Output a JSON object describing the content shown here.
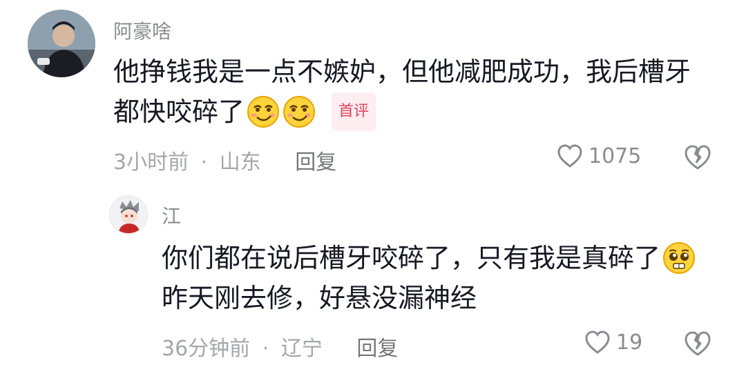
{
  "comments": [
    {
      "username": "阿豪啥",
      "text_line1": "他挣钱我是一点不嫉妒，但他减肥成功，我后槽牙",
      "text_line2": "都快咬碎了",
      "badge": "首评",
      "time": "3小时前",
      "separator": "·",
      "location": "山东",
      "reply_label": "回复",
      "likes": "1075",
      "emojis": [
        "smirk-face-emoji",
        "smirk-face-emoji"
      ]
    }
  ],
  "replies": [
    {
      "username": "江",
      "text_line1": "你们都在说后槽牙咬碎了，只有我是真碎了",
      "text_line2": "昨天刚去修，好悬没漏神经",
      "time": "36分钟前",
      "separator": "·",
      "location": "辽宁",
      "reply_label": "回复",
      "likes": "19",
      "emojis": [
        "pleading-face-emoji"
      ]
    }
  ],
  "colors": {
    "text": "#161823",
    "meta": "#a5a6ab",
    "badge_text": "#e3445c",
    "badge_bg": "#fdeef1"
  },
  "icons": [
    "heart-outline-icon",
    "broken-heart-icon"
  ]
}
